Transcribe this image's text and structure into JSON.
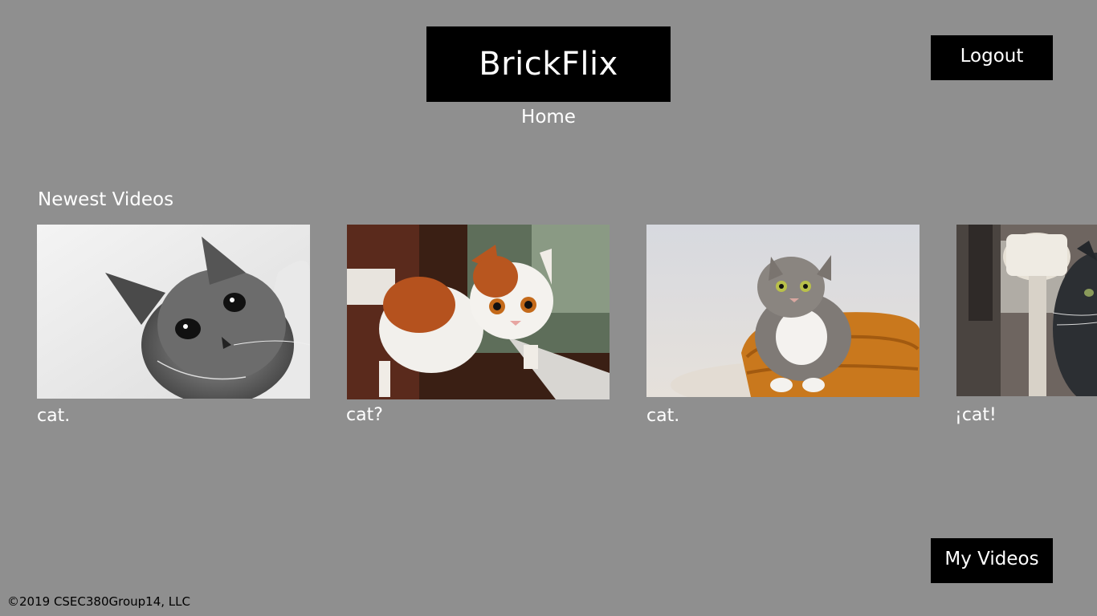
{
  "header": {
    "logo_text": "BrickFlix",
    "nav_home": "Home",
    "logout_label": "Logout"
  },
  "newest": {
    "title": "Newest Videos",
    "videos": [
      {
        "caption": "cat.",
        "thumbnail": "kitten-black-white"
      },
      {
        "caption": "cat?",
        "thumbnail": "calico-cat-window"
      },
      {
        "caption": "cat.",
        "thumbnail": "gray-cat-basket"
      },
      {
        "caption": "¡cat!",
        "thumbnail": "dark-cat-lamp"
      }
    ]
  },
  "actions": {
    "my_videos_label": "My Videos"
  },
  "footer": {
    "copyright": "©2019 CSEC380Group14, LLC"
  },
  "colors": {
    "background": "#8f8f8f",
    "button_bg": "#000000",
    "text": "#ffffff"
  }
}
